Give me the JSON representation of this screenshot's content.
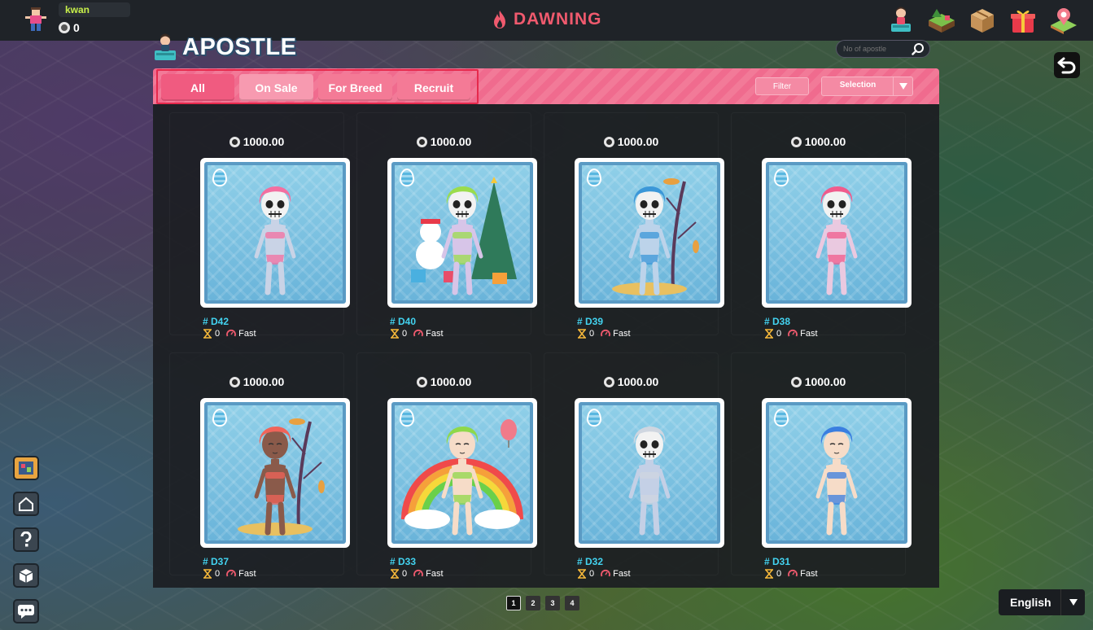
{
  "user": {
    "name": "kwan",
    "balance": "0"
  },
  "brand": {
    "name": "DAWNING"
  },
  "top_icons": [
    "apostle-icon",
    "land-icon",
    "box-icon",
    "gift-icon",
    "map-pin-icon"
  ],
  "section": {
    "title": "APOSTLE"
  },
  "search": {
    "placeholder": "No of apostle"
  },
  "tabs": [
    {
      "label": "All"
    },
    {
      "label": "On Sale"
    },
    {
      "label": "For Breed"
    },
    {
      "label": "Recruit"
    }
  ],
  "filter": {
    "label": "Filter"
  },
  "selection": {
    "label": "Selection"
  },
  "cards": [
    {
      "price": "1000.00",
      "id": "# D42",
      "gen": "0",
      "speed": "Fast",
      "hair": "#f36fa0",
      "skin": "#c9d3e6",
      "skull": true,
      "bg": "plain"
    },
    {
      "price": "1000.00",
      "id": "# D40",
      "gen": "0",
      "speed": "Fast",
      "hair": "#9bdc4c",
      "skin": "#d7c5e8",
      "skull": true,
      "bg": "christmas"
    },
    {
      "price": "1000.00",
      "id": "# D39",
      "gen": "0",
      "speed": "Fast",
      "hair": "#3b97d8",
      "skin": "#bcd3ea",
      "skull": true,
      "bg": "tree"
    },
    {
      "price": "1000.00",
      "id": "# D38",
      "gen": "0",
      "speed": "Fast",
      "hair": "#f05b8c",
      "skin": "#eac9e0",
      "skull": true,
      "bg": "plain"
    },
    {
      "price": "1000.00",
      "id": "# D37",
      "gen": "0",
      "speed": "Fast",
      "hair": "#f0645a",
      "skin": "#8a5a4a",
      "skull": false,
      "bg": "tree"
    },
    {
      "price": "1000.00",
      "id": "# D33",
      "gen": "0",
      "speed": "Fast",
      "hair": "#8fd84a",
      "skin": "#f6dcc8",
      "skull": false,
      "bg": "rainbow"
    },
    {
      "price": "1000.00",
      "id": "# D32",
      "gen": "0",
      "speed": "Fast",
      "hair": "#cfd6e0",
      "skin": "#c4d0e6",
      "skull": true,
      "bg": "plain"
    },
    {
      "price": "1000.00",
      "id": "# D31",
      "gen": "0",
      "speed": "Fast",
      "hair": "#3a7ee0",
      "skin": "#f6dcc8",
      "skull": false,
      "bg": "plain"
    }
  ],
  "pagination": {
    "pages": [
      "1",
      "2",
      "3",
      "4"
    ],
    "current": "1"
  },
  "language": {
    "label": "English"
  },
  "left_tools": [
    "land-tool-icon",
    "home-icon",
    "help-icon",
    "cube-icon",
    "chat-icon"
  ],
  "colors": {
    "accent_pink": "#f06b8e",
    "tab_border": "#e6294c",
    "id_cyan": "#43d3f0",
    "brand_red": "#f05a6e"
  }
}
